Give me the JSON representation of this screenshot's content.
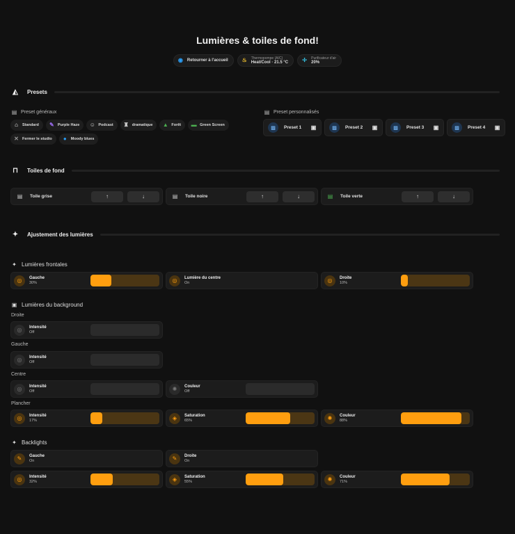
{
  "title": "Lumières & toiles de fond!",
  "header_chips": [
    {
      "label": "Retourner à l'accueil",
      "icon": "home-circle-icon",
      "color": "#2a9df4"
    },
    {
      "label": "Heat/Cool · 21.5 °C",
      "sub": "Thermopompe (A/C)",
      "icon": "thermostat-icon",
      "color": "#f2c12e"
    },
    {
      "label": "20%",
      "sub": "Purificateur d'air",
      "icon": "fan-icon",
      "color": "#35c0e0"
    }
  ],
  "sections": {
    "presets": "Presets",
    "toiles": "Toiles de fond",
    "ajustement": "Ajustement des lumières"
  },
  "presets_general": {
    "label": "Preset généraux",
    "items": [
      {
        "label": "Standard",
        "icon": "home-icon",
        "glyph": "⌂",
        "color": "#ffffff"
      },
      {
        "label": "Purple Haze",
        "icon": "palette-icon",
        "glyph": "✎",
        "color": "#9b6cf0"
      },
      {
        "label": "Podcast",
        "icon": "account-group-icon",
        "glyph": "☺",
        "color": "#cccccc"
      },
      {
        "label": "dramatique",
        "icon": "theater-icon",
        "glyph": "♜",
        "color": "#cccccc"
      },
      {
        "label": "Forêt",
        "icon": "tree-icon",
        "glyph": "▲",
        "color": "#4caf50"
      },
      {
        "label": "Green Screen",
        "icon": "green-screen-icon",
        "glyph": "▬",
        "color": "#4caf50"
      },
      {
        "label": "Fermer le studio",
        "icon": "lightbulb-off-icon",
        "glyph": "✕",
        "color": "#999999"
      },
      {
        "label": "Moody blues",
        "icon": "blue-circle-icon",
        "glyph": "●",
        "color": "#2a9df4"
      }
    ]
  },
  "presets_custom": {
    "label": "Preset personnalisés",
    "items": [
      {
        "label": "Preset 1"
      },
      {
        "label": "Preset 2"
      },
      {
        "label": "Preset 3"
      },
      {
        "label": "Preset 4"
      }
    ]
  },
  "toiles": [
    {
      "label": "Toile grise",
      "color": "#cccccc"
    },
    {
      "label": "Toile noire",
      "color": "#cccccc"
    },
    {
      "label": "Toile verte",
      "color": "#4caf50"
    }
  ],
  "toile_buttons": {
    "up": "↑",
    "down": "↓"
  },
  "lights": {
    "frontales": {
      "label": "Lumières frontales",
      "cards": [
        {
          "label": "Gauche",
          "state": "30%",
          "value": 30,
          "on": true
        },
        {
          "label": "Lumière du centre",
          "state": "On",
          "value": null,
          "on": true
        },
        {
          "label": "Droite",
          "state": "10%",
          "value": 10,
          "on": true
        }
      ]
    },
    "background": {
      "label": "Lumières du background",
      "droite": {
        "label": "Droite",
        "cards": [
          {
            "label": "Intensité",
            "state": "Off",
            "value": 0,
            "on": false
          }
        ]
      },
      "gauche": {
        "label": "Gauche",
        "cards": [
          {
            "label": "Intensité",
            "state": "Off",
            "value": 0,
            "on": false
          }
        ]
      },
      "centre": {
        "label": "Centre",
        "cards": [
          {
            "label": "Intensité",
            "state": "Off",
            "value": 0,
            "on": false
          },
          {
            "label": "Couleur",
            "state": "Off",
            "value": 0,
            "on": false,
            "icon": "palette"
          }
        ]
      },
      "plancher": {
        "label": "Plancher",
        "cards": [
          {
            "label": "Intensité",
            "state": "17%",
            "value": 17,
            "on": true
          },
          {
            "label": "Saturation",
            "state": "65%",
            "value": 65,
            "on": true,
            "icon": "drop"
          },
          {
            "label": "Couleur",
            "state": "88%",
            "value": 88,
            "on": true,
            "icon": "palette"
          }
        ]
      }
    },
    "backlights": {
      "label": "Backlights",
      "row1": [
        {
          "label": "Gauche",
          "state": "On",
          "value": null,
          "on": true,
          "icon": "spot"
        },
        {
          "label": "Droite",
          "state": "On",
          "value": null,
          "on": true,
          "icon": "spot"
        }
      ],
      "row2": [
        {
          "label": "Intensité",
          "state": "32%",
          "value": 32,
          "on": true
        },
        {
          "label": "Saturation",
          "state": "55%",
          "value": 55,
          "on": true,
          "icon": "drop"
        },
        {
          "label": "Couleur",
          "state": "71%",
          "value": 71,
          "on": true,
          "icon": "palette"
        }
      ]
    }
  }
}
